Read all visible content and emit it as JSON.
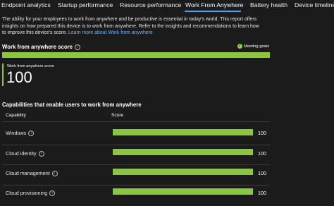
{
  "tabs": [
    {
      "label": "Endpoint analytics",
      "active": false
    },
    {
      "label": "Startup performance",
      "active": false
    },
    {
      "label": "Resource performance",
      "active": false
    },
    {
      "label": "Work From Anywhere",
      "active": true
    },
    {
      "label": "Battery health",
      "active": false
    },
    {
      "label": "Device timeline",
      "active": false
    }
  ],
  "description": {
    "text": "The ability for your employees to work from anywhere and be productive is essential in today's world. This report offers insights on how prepared this device is to work from anywhere. Refer to the insights and recommendations to learn how to improve this device's score.",
    "link": "Learn more about Work from anywhere"
  },
  "score_section": {
    "title": "Work from anywhere score",
    "status": "Meeting goals",
    "bar_percent": 100,
    "card_label": "Work from anywhere score",
    "card_value": "100"
  },
  "capabilities": {
    "title": "Capabilities that enable users to work from anywhere",
    "col_capability": "Capability",
    "col_score": "Score",
    "rows": [
      {
        "name": "Windows",
        "score": "100",
        "percent": 100
      },
      {
        "name": "Cloud identity",
        "score": "100",
        "percent": 100
      },
      {
        "name": "Cloud management",
        "score": "100",
        "percent": 100
      },
      {
        "name": "Cloud provisioning",
        "score": "100",
        "percent": 100
      }
    ]
  },
  "colors": {
    "accent": "#8cc63f",
    "link": "#6cb6ff",
    "tab_underline": "#4aa3ff",
    "background": "#1b1b1b"
  },
  "icons": [
    "info-icon",
    "check-circle-icon"
  ]
}
